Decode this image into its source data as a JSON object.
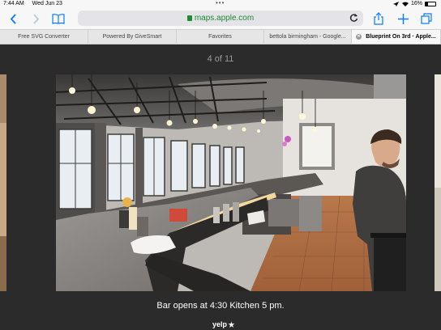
{
  "status_bar": {
    "time": "7:44 AM",
    "date": "Wed Jun 23",
    "battery": "16%"
  },
  "toolbar": {
    "url": "maps.apple.com"
  },
  "tabs": [
    {
      "label": "Free SVG Converter"
    },
    {
      "label": "Powered By GiveSmart"
    },
    {
      "label": "Favorites"
    },
    {
      "label": "bettola birmingham - Google..."
    },
    {
      "label": "Blueprint On 3rd · Apple..."
    }
  ],
  "gallery": {
    "counter": "4 of 11",
    "caption": "Bar opens at 4:30 Kitchen 5 pm.",
    "credit": "yelp"
  },
  "colors": {
    "accent": "#0a7aff",
    "secure": "#1f8a35",
    "background": "#2b2b2b"
  },
  "icons": {
    "back": "chevron-left-icon",
    "forward": "chevron-right-icon",
    "reader": "book-icon",
    "share": "share-icon",
    "new_tab": "plus-icon",
    "tabs": "tabs-icon",
    "reload": "reload-icon"
  }
}
